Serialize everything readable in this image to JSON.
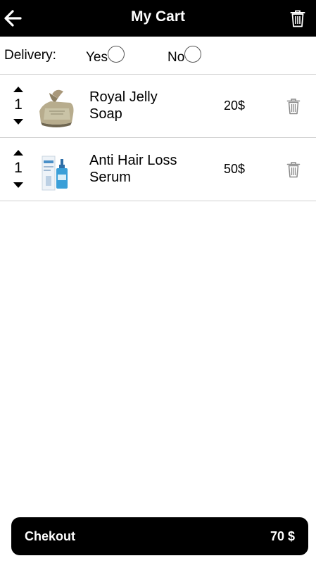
{
  "header": {
    "title": "My Cart",
    "back_icon": "arrow-left-icon",
    "clear_icon": "trash-icon"
  },
  "delivery": {
    "label": "Delivery:",
    "options": [
      {
        "label": "Yes",
        "selected": false
      },
      {
        "label": "No",
        "selected": false
      }
    ]
  },
  "items": [
    {
      "name": "Royal Jelly\nSoap",
      "quantity": "1",
      "price": "20$",
      "image": "soap-bar-image"
    },
    {
      "name": "Anti Hair Loss\nSerum",
      "quantity": "1",
      "price": "50$",
      "image": "serum-bottle-image"
    }
  ],
  "checkout": {
    "label": "Chekout",
    "total": "70 $"
  },
  "colors": {
    "header_bg": "#000000",
    "button_bg": "#000000",
    "divider": "#cfcfcf",
    "icon_gray": "#8a8a8a"
  }
}
